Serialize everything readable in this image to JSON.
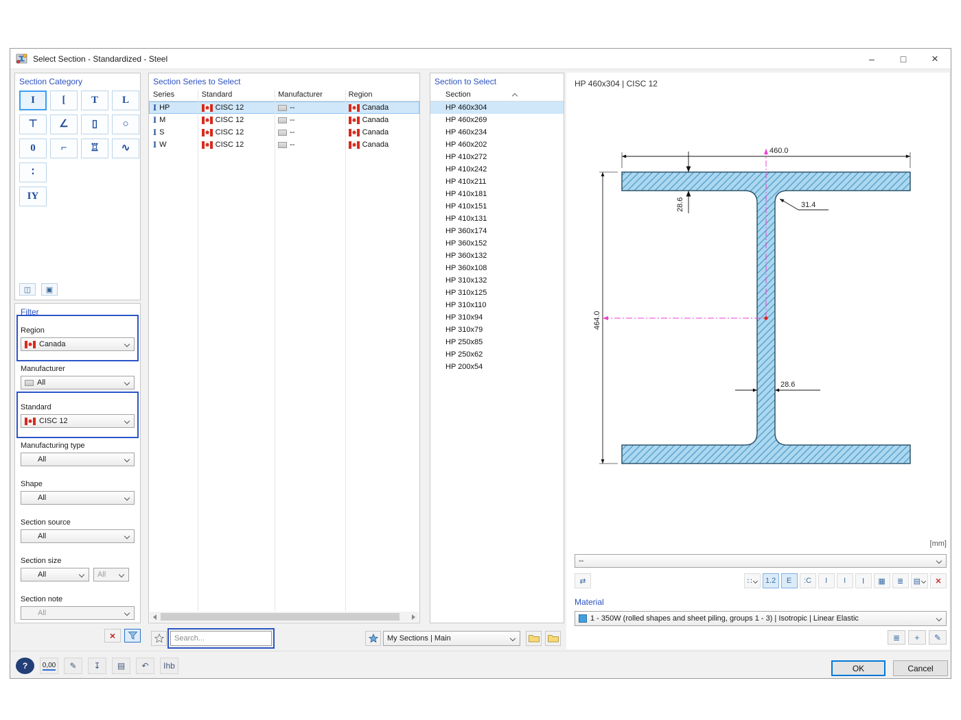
{
  "window": {
    "title": "Select Section - Standardized - Steel",
    "controls": {
      "minimize": "–",
      "maximize": "□",
      "close": "×"
    }
  },
  "category": {
    "title": "Section Category",
    "items": [
      {
        "name": "i-sections-category",
        "glyph": "I",
        "selected": true
      },
      {
        "name": "channel-sections-category",
        "glyph": "["
      },
      {
        "name": "tee-sections-category",
        "glyph": "T"
      },
      {
        "name": "angle-sections-category",
        "glyph": "L"
      },
      {
        "name": "half-i-sections-category",
        "glyph": "⊤"
      },
      {
        "name": "rotated-angle-sections-category",
        "glyph": "∠"
      },
      {
        "name": "rectangular-hollow-sections-category",
        "glyph": "▯"
      },
      {
        "name": "circular-hollow-sections-category",
        "glyph": "○"
      },
      {
        "name": "round-bar-sections-category",
        "glyph": "0"
      },
      {
        "name": "cold-formed-sections-category",
        "glyph": "⌐"
      },
      {
        "name": "rail-sections-category",
        "glyph": "♖"
      },
      {
        "name": "corrugated-sections-category",
        "glyph": "∿"
      },
      {
        "name": "dot-sections-category",
        "glyph": "∶"
      },
      {
        "name": "combined-sections-category",
        "glyph": "IY"
      }
    ],
    "extra_buttons": [
      {
        "name": "compare-sections-button",
        "glyph": "◫"
      },
      {
        "name": "section-info-button",
        "glyph": "▣"
      }
    ]
  },
  "filter": {
    "title": "Filter",
    "region": {
      "label": "Region",
      "value": "Canada"
    },
    "manufacturer": {
      "label": "Manufacturer",
      "value": "All"
    },
    "standard": {
      "label": "Standard",
      "value": "CISC 12"
    },
    "manufacturing_type": {
      "label": "Manufacturing type",
      "value": "All"
    },
    "shape": {
      "label": "Shape",
      "value": "All"
    },
    "section_source": {
      "label": "Section source",
      "value": "All"
    },
    "section_size": {
      "label": "Section size",
      "value": "All",
      "value2": "All"
    },
    "section_note": {
      "label": "Section note",
      "value": "All"
    }
  },
  "series_panel": {
    "title": "Section Series to Select",
    "columns": {
      "series": "Series",
      "standard": "Standard",
      "manufacturer": "Manufacturer",
      "region": "Region"
    },
    "rows": [
      {
        "series": "HP",
        "standard": "CISC 12",
        "manufacturer": "--",
        "region": "Canada",
        "selected": true
      },
      {
        "series": "M",
        "standard": "CISC 12",
        "manufacturer": "--",
        "region": "Canada"
      },
      {
        "series": "S",
        "standard": "CISC 12",
        "manufacturer": "--",
        "region": "Canada"
      },
      {
        "series": "W",
        "standard": "CISC 12",
        "manufacturer": "--",
        "region": "Canada"
      }
    ],
    "search": {
      "placeholder": "Search..."
    },
    "favorites_group": "My Sections | Main"
  },
  "section_list": {
    "title": "Section to Select",
    "column": "Section",
    "items": [
      {
        "label": "HP 460x304",
        "selected": true
      },
      {
        "label": "HP 460x269"
      },
      {
        "label": "HP 460x234"
      },
      {
        "label": "HP 460x202"
      },
      {
        "label": "HP 410x272"
      },
      {
        "label": "HP 410x242"
      },
      {
        "label": "HP 410x211"
      },
      {
        "label": "HP 410x181"
      },
      {
        "label": "HP 410x151"
      },
      {
        "label": "HP 410x131"
      },
      {
        "label": "HP 360x174"
      },
      {
        "label": "HP 360x152"
      },
      {
        "label": "HP 360x132"
      },
      {
        "label": "HP 360x108"
      },
      {
        "label": "HP 310x132"
      },
      {
        "label": "HP 310x125"
      },
      {
        "label": "HP 310x110"
      },
      {
        "label": "HP 310x94"
      },
      {
        "label": "HP 310x79"
      },
      {
        "label": "HP 250x85"
      },
      {
        "label": "HP 250x62"
      },
      {
        "label": "HP 200x54"
      }
    ]
  },
  "preview": {
    "title": "HP 460x304 | CISC 12",
    "units_label": "[mm]",
    "combo_value": "--",
    "dims": {
      "width": "460.0",
      "height": "464.0",
      "flange_thickness": "28.6",
      "web_thickness": "28.6",
      "fillet_radius": "31.4"
    },
    "left_tool": {
      "glyph": "⇄"
    },
    "toolbar": [
      {
        "name": "display-points-button",
        "glyph": "∷",
        "caret": true
      },
      {
        "name": "display-dimensions-button",
        "glyph": "1.2",
        "pressed": true
      },
      {
        "name": "display-edges-button",
        "glyph": "E",
        "pressed": true
      },
      {
        "name": "display-c-points-button",
        "glyph": ":C"
      },
      {
        "name": "display-axes-button",
        "glyph": "I"
      },
      {
        "name": "display-profile-button",
        "glyph": "I"
      },
      {
        "name": "display-stress-points-button",
        "glyph": "Ⅰ"
      },
      {
        "name": "display-grid-button",
        "glyph": "▦"
      },
      {
        "name": "display-values-button",
        "glyph": "≣"
      },
      {
        "name": "print-button",
        "glyph": "▤",
        "caret": true
      },
      {
        "name": "zoom-reset-button",
        "glyph": "✕",
        "danger": true
      }
    ]
  },
  "material": {
    "title": "Material",
    "value": "1 - 350W (rolled shapes and sheet piling, groups 1 - 3) | Isotropic | Linear Elastic",
    "buttons": [
      {
        "name": "material-library-button",
        "glyph": "≣"
      },
      {
        "name": "new-material-button",
        "glyph": "+"
      },
      {
        "name": "edit-material-button",
        "glyph": "✎"
      }
    ]
  },
  "footer": {
    "ok": "OK",
    "cancel": "Cancel",
    "tools": [
      {
        "name": "help-button",
        "glyph": "?",
        "dark": true
      },
      {
        "name": "decimal-places-button",
        "glyph": "0,00",
        "accent": true
      },
      {
        "name": "style-button",
        "glyph": "✎"
      },
      {
        "name": "save-template-button",
        "glyph": "↧"
      },
      {
        "name": "copy-button",
        "glyph": "▤"
      },
      {
        "name": "undo-button",
        "glyph": "↶"
      },
      {
        "name": "section-parameters-button",
        "glyph": "Ihb",
        "small": true
      }
    ]
  }
}
